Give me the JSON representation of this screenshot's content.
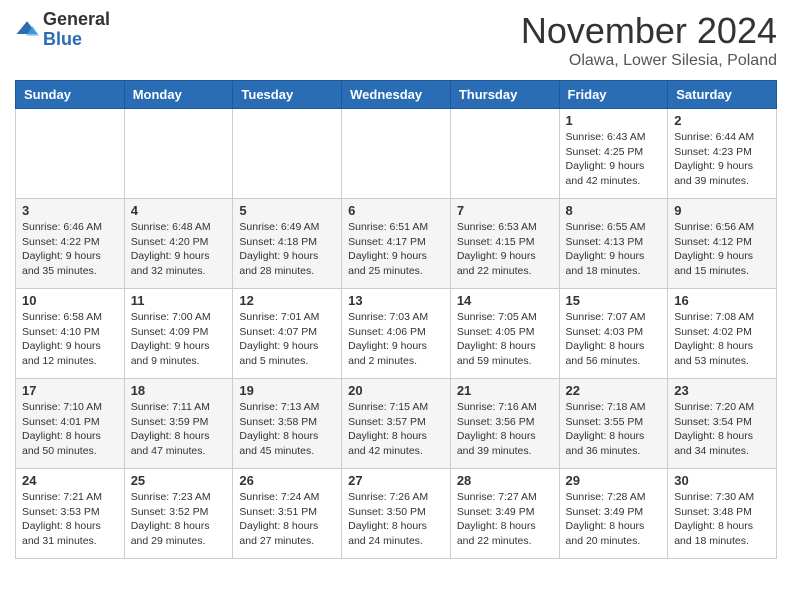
{
  "logo": {
    "general": "General",
    "blue": "Blue"
  },
  "header": {
    "month": "November 2024",
    "location": "Olawa, Lower Silesia, Poland"
  },
  "weekdays": [
    "Sunday",
    "Monday",
    "Tuesday",
    "Wednesday",
    "Thursday",
    "Friday",
    "Saturday"
  ],
  "weeks": [
    [
      {
        "day": "",
        "info": ""
      },
      {
        "day": "",
        "info": ""
      },
      {
        "day": "",
        "info": ""
      },
      {
        "day": "",
        "info": ""
      },
      {
        "day": "",
        "info": ""
      },
      {
        "day": "1",
        "info": "Sunrise: 6:43 AM\nSunset: 4:25 PM\nDaylight: 9 hours and 42 minutes."
      },
      {
        "day": "2",
        "info": "Sunrise: 6:44 AM\nSunset: 4:23 PM\nDaylight: 9 hours and 39 minutes."
      }
    ],
    [
      {
        "day": "3",
        "info": "Sunrise: 6:46 AM\nSunset: 4:22 PM\nDaylight: 9 hours and 35 minutes."
      },
      {
        "day": "4",
        "info": "Sunrise: 6:48 AM\nSunset: 4:20 PM\nDaylight: 9 hours and 32 minutes."
      },
      {
        "day": "5",
        "info": "Sunrise: 6:49 AM\nSunset: 4:18 PM\nDaylight: 9 hours and 28 minutes."
      },
      {
        "day": "6",
        "info": "Sunrise: 6:51 AM\nSunset: 4:17 PM\nDaylight: 9 hours and 25 minutes."
      },
      {
        "day": "7",
        "info": "Sunrise: 6:53 AM\nSunset: 4:15 PM\nDaylight: 9 hours and 22 minutes."
      },
      {
        "day": "8",
        "info": "Sunrise: 6:55 AM\nSunset: 4:13 PM\nDaylight: 9 hours and 18 minutes."
      },
      {
        "day": "9",
        "info": "Sunrise: 6:56 AM\nSunset: 4:12 PM\nDaylight: 9 hours and 15 minutes."
      }
    ],
    [
      {
        "day": "10",
        "info": "Sunrise: 6:58 AM\nSunset: 4:10 PM\nDaylight: 9 hours and 12 minutes."
      },
      {
        "day": "11",
        "info": "Sunrise: 7:00 AM\nSunset: 4:09 PM\nDaylight: 9 hours and 9 minutes."
      },
      {
        "day": "12",
        "info": "Sunrise: 7:01 AM\nSunset: 4:07 PM\nDaylight: 9 hours and 5 minutes."
      },
      {
        "day": "13",
        "info": "Sunrise: 7:03 AM\nSunset: 4:06 PM\nDaylight: 9 hours and 2 minutes."
      },
      {
        "day": "14",
        "info": "Sunrise: 7:05 AM\nSunset: 4:05 PM\nDaylight: 8 hours and 59 minutes."
      },
      {
        "day": "15",
        "info": "Sunrise: 7:07 AM\nSunset: 4:03 PM\nDaylight: 8 hours and 56 minutes."
      },
      {
        "day": "16",
        "info": "Sunrise: 7:08 AM\nSunset: 4:02 PM\nDaylight: 8 hours and 53 minutes."
      }
    ],
    [
      {
        "day": "17",
        "info": "Sunrise: 7:10 AM\nSunset: 4:01 PM\nDaylight: 8 hours and 50 minutes."
      },
      {
        "day": "18",
        "info": "Sunrise: 7:11 AM\nSunset: 3:59 PM\nDaylight: 8 hours and 47 minutes."
      },
      {
        "day": "19",
        "info": "Sunrise: 7:13 AM\nSunset: 3:58 PM\nDaylight: 8 hours and 45 minutes."
      },
      {
        "day": "20",
        "info": "Sunrise: 7:15 AM\nSunset: 3:57 PM\nDaylight: 8 hours and 42 minutes."
      },
      {
        "day": "21",
        "info": "Sunrise: 7:16 AM\nSunset: 3:56 PM\nDaylight: 8 hours and 39 minutes."
      },
      {
        "day": "22",
        "info": "Sunrise: 7:18 AM\nSunset: 3:55 PM\nDaylight: 8 hours and 36 minutes."
      },
      {
        "day": "23",
        "info": "Sunrise: 7:20 AM\nSunset: 3:54 PM\nDaylight: 8 hours and 34 minutes."
      }
    ],
    [
      {
        "day": "24",
        "info": "Sunrise: 7:21 AM\nSunset: 3:53 PM\nDaylight: 8 hours and 31 minutes."
      },
      {
        "day": "25",
        "info": "Sunrise: 7:23 AM\nSunset: 3:52 PM\nDaylight: 8 hours and 29 minutes."
      },
      {
        "day": "26",
        "info": "Sunrise: 7:24 AM\nSunset: 3:51 PM\nDaylight: 8 hours and 27 minutes."
      },
      {
        "day": "27",
        "info": "Sunrise: 7:26 AM\nSunset: 3:50 PM\nDaylight: 8 hours and 24 minutes."
      },
      {
        "day": "28",
        "info": "Sunrise: 7:27 AM\nSunset: 3:49 PM\nDaylight: 8 hours and 22 minutes."
      },
      {
        "day": "29",
        "info": "Sunrise: 7:28 AM\nSunset: 3:49 PM\nDaylight: 8 hours and 20 minutes."
      },
      {
        "day": "30",
        "info": "Sunrise: 7:30 AM\nSunset: 3:48 PM\nDaylight: 8 hours and 18 minutes."
      }
    ]
  ]
}
